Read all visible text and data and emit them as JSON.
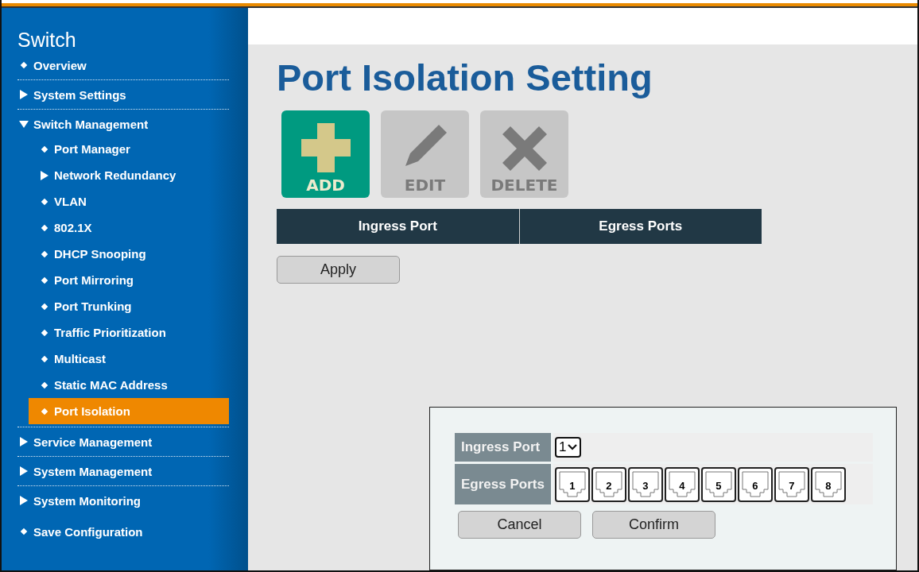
{
  "sidebar": {
    "title": "Switch",
    "items": [
      {
        "kind": "leaf",
        "label": "Overview",
        "selected": false,
        "separator": true
      },
      {
        "kind": "group",
        "label": "System Settings",
        "expanded": false,
        "selected": false,
        "separator": true
      },
      {
        "kind": "group",
        "label": "Switch Management",
        "expanded": true,
        "selected": false,
        "separator": true,
        "children": [
          {
            "kind": "leaf",
            "label": "Port Manager",
            "selected": false
          },
          {
            "kind": "group",
            "label": "Network Redundancy",
            "expanded": false,
            "selected": false
          },
          {
            "kind": "leaf",
            "label": "VLAN",
            "selected": false
          },
          {
            "kind": "leaf",
            "label": "802.1X",
            "selected": false
          },
          {
            "kind": "leaf",
            "label": "DHCP Snooping",
            "selected": false
          },
          {
            "kind": "leaf",
            "label": "Port Mirroring",
            "selected": false
          },
          {
            "kind": "leaf",
            "label": "Port Trunking",
            "selected": false
          },
          {
            "kind": "leaf",
            "label": "Traffic Prioritization",
            "selected": false
          },
          {
            "kind": "leaf",
            "label": "Multicast",
            "selected": false
          },
          {
            "kind": "leaf",
            "label": "Static MAC Address",
            "selected": false
          },
          {
            "kind": "leaf",
            "label": "Port Isolation",
            "selected": true
          }
        ]
      },
      {
        "kind": "group",
        "label": "Service Management",
        "expanded": false,
        "selected": false,
        "separator": true
      },
      {
        "kind": "group",
        "label": "System Management",
        "expanded": false,
        "selected": false,
        "separator": true
      },
      {
        "kind": "group",
        "label": "System Monitoring",
        "expanded": false,
        "selected": false,
        "separator": false
      },
      {
        "kind": "leaf",
        "label": "Save Configuration",
        "selected": false,
        "separator": false
      }
    ]
  },
  "page_title": "Port Isolation Setting",
  "toolbar": [
    {
      "kind": "add",
      "label": "ADD",
      "disabled": false
    },
    {
      "kind": "edit",
      "label": "EDIT",
      "disabled": true
    },
    {
      "kind": "delete",
      "label": "DELETE",
      "disabled": true
    }
  ],
  "table": {
    "columns": [
      "Ingress Port",
      "Egress Ports"
    ]
  },
  "apply_button": "Apply",
  "dialog": {
    "ingress_label": "Ingress Port",
    "ingress_value": "1",
    "egress_label": "Egress Ports",
    "ports": [
      "1",
      "2",
      "3",
      "4",
      "5",
      "6",
      "7",
      "8"
    ],
    "buttons": [
      "Cancel",
      "Confirm"
    ]
  }
}
